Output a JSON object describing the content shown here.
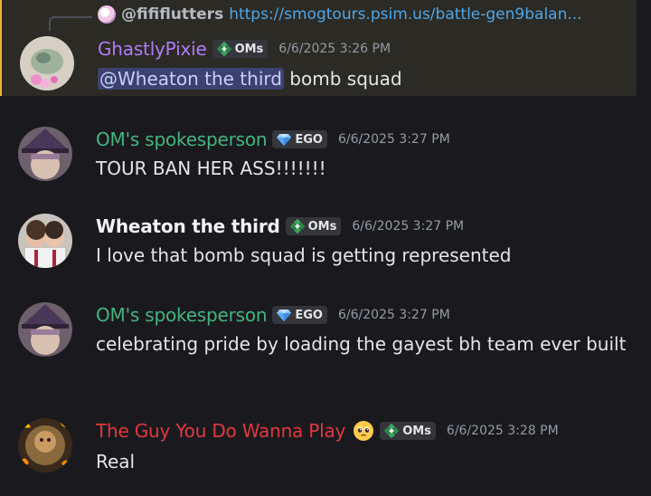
{
  "colors": {
    "background": "#1a1a1e",
    "highlight_bg": "#2b2a25",
    "highlight_border": "#f0b232",
    "pixie": "#b07cf4",
    "spokesperson": "#43b581",
    "wheaton": "#f2f3f5",
    "guy": "#e0383e",
    "mention_bg": "#3c4270",
    "timestamp": "#949ba4"
  },
  "reply": {
    "username": "@fififlutters",
    "link": "https://smogtours.psim.us/battle-gen9balan..."
  },
  "messages": [
    {
      "username": "GhastlyPixie",
      "tag": "OMs",
      "tag_icon": "green-diamond-icon",
      "timestamp": "6/6/2025 3:26 PM",
      "mention": "@Wheaton the third",
      "text": " bomb squad"
    },
    {
      "username": "OM's spokesperson",
      "tag": "EGO",
      "tag_icon": "gem-icon",
      "timestamp": "6/6/2025 3:27 PM",
      "text": "TOUR BAN HER ASS!!!!!!!"
    },
    {
      "username": "Wheaton the third",
      "tag": "OMs",
      "tag_icon": "green-diamond-icon",
      "timestamp": "6/6/2025 3:27 PM",
      "text": "I love that bomb squad is getting represented"
    },
    {
      "username": "OM's spokesperson",
      "tag": "EGO",
      "tag_icon": "gem-icon",
      "timestamp": "6/6/2025 3:27 PM",
      "text": "celebrating pride by loading the gayest bh team ever built"
    },
    {
      "username": "The Guy You Do Wanna Play",
      "emoji": "pleading-face-icon",
      "tag": "OMs",
      "tag_icon": "green-diamond-icon",
      "timestamp": "6/6/2025 3:28 PM",
      "text": "Real"
    }
  ]
}
